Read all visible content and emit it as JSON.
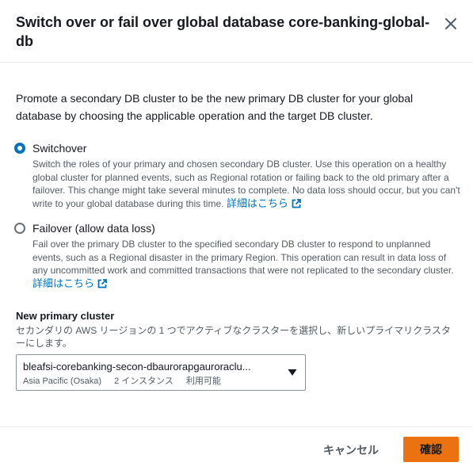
{
  "modal": {
    "title": "Switch over or fail over global database core-banking-global-db",
    "intro": "Promote a secondary DB cluster to be the new primary DB cluster for your global database by choosing the applicable operation and the target DB cluster."
  },
  "options": {
    "switchover": {
      "label": "Switchover",
      "description": "Switch the roles of your primary and chosen secondary DB cluster. Use this operation on a healthy global cluster for planned events, such as Regional rotation or failing back to the old primary after a failover. This change might take several minutes to complete. No data loss should occur, but you can't write to your global database during this time.",
      "link": "詳細はこちら",
      "selected": true
    },
    "failover": {
      "label": "Failover (allow data loss)",
      "description": "Fail over the primary DB cluster to the specified secondary DB cluster to respond to unplanned events, such as a Regional disaster in the primary Region. This operation can result in data loss of any uncommitted work and committed transactions that were not replicated to the secondary cluster.",
      "link": "詳細はこちら",
      "selected": false
    }
  },
  "primary_cluster": {
    "label": "New primary cluster",
    "description": "セカンダリの AWS リージョンの 1 つでアクティブなクラスターを選択し、新しいプライマリクラスターにします。",
    "value": "bleafsi-corebanking-secon-dbaurorapgauroraclu...",
    "region": "Asia Pacific (Osaka)",
    "instances": "2 インスタンス",
    "status": "利用可能"
  },
  "footer": {
    "cancel_label": "キャンセル",
    "confirm_label": "確認"
  },
  "colors": {
    "accent": "#0073bb",
    "primary_button": "#ec7211",
    "text": "#16191f",
    "secondary_text": "#545b64"
  },
  "icons": {
    "close": "close-icon",
    "external_link": "external-link-icon",
    "dropdown": "caret-down-icon"
  }
}
